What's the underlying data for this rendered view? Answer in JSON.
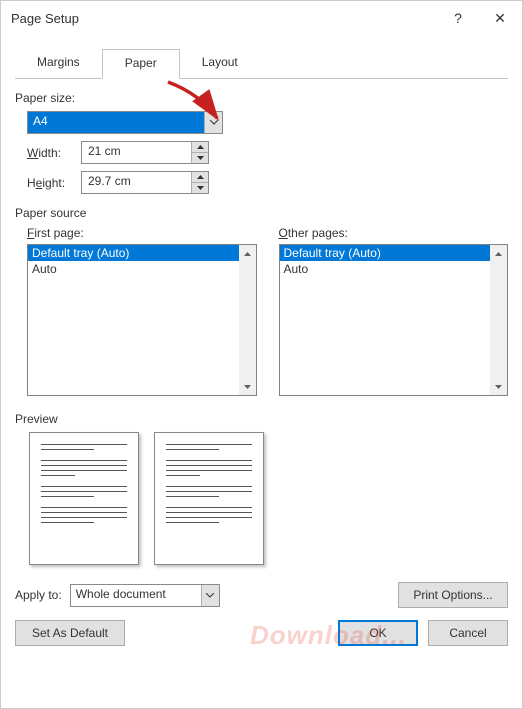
{
  "title": "Page Setup",
  "help_char": "?",
  "close_char": "✕",
  "tabs": {
    "margins": "Margins",
    "paper": "Paper",
    "layout": "Layout"
  },
  "paper": {
    "size_label": "Paper size:",
    "size_value": "A4",
    "width_label_pre": "",
    "width_letter": "W",
    "width_label_post": "idth:",
    "width_value": "21 cm",
    "height_label_pre": "H",
    "height_letter": "e",
    "height_label_post": "ight:",
    "height_value": "29.7 cm"
  },
  "source": {
    "label": "Paper source",
    "first_letter": "F",
    "first_label_post": "irst page:",
    "other_letter": "O",
    "other_label_post": "ther pages:",
    "options": {
      "default": "Default tray (Auto)",
      "auto": "Auto"
    }
  },
  "preview_label": "Preview",
  "apply": {
    "label": "Apply to:",
    "value": "Whole document"
  },
  "buttons": {
    "print_options": "Print Options...",
    "set_default": "Set As Default",
    "ok": "OK",
    "cancel": "Cancel"
  },
  "watermark": "Download..."
}
